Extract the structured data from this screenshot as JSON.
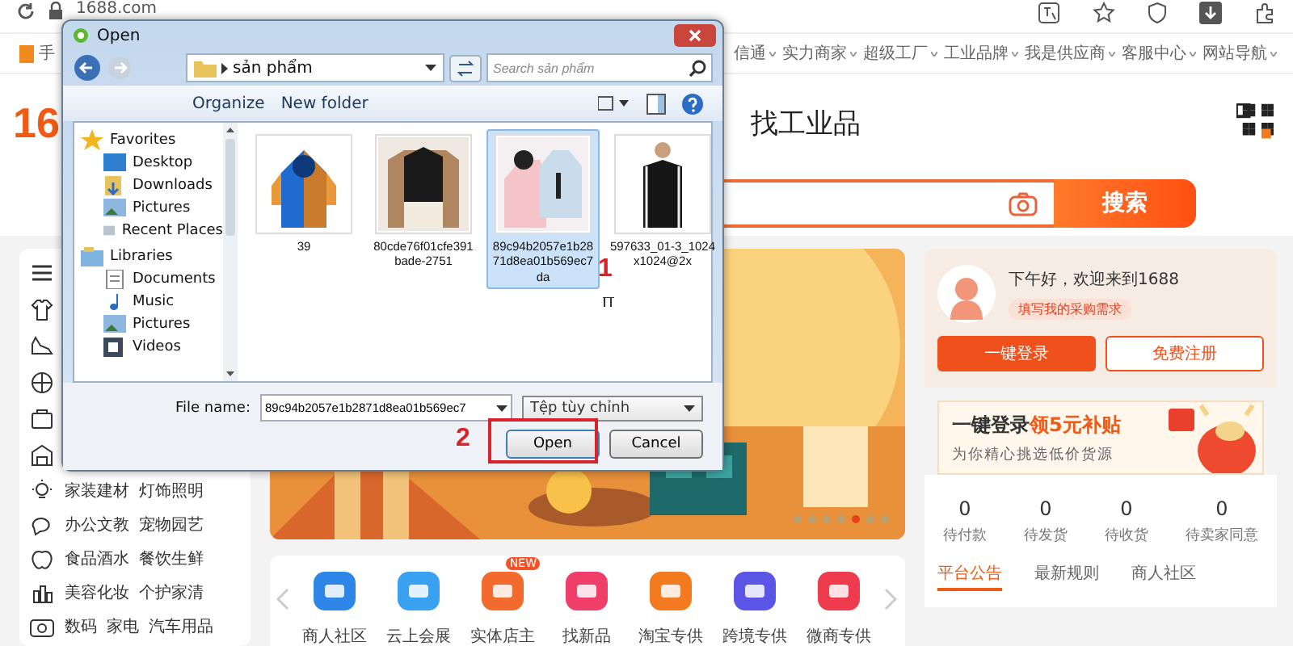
{
  "browser": {
    "url": "1688.com"
  },
  "top_nav": [
    {
      "label": "手"
    },
    {
      "label": "信通"
    },
    {
      "label": "实力商家"
    },
    {
      "label": "超级工厂"
    },
    {
      "label": "工业品牌"
    },
    {
      "label": "我是供应商"
    },
    {
      "label": "客服中心"
    },
    {
      "label": "网站导航"
    }
  ],
  "header": {
    "logo": "16",
    "title": "找工业品"
  },
  "search": {
    "button": "搜索"
  },
  "categories": [
    {
      "labels": [
        "家装建材",
        "灯饰照明"
      ]
    },
    {
      "labels": [
        "办公文教",
        "宠物园艺"
      ]
    },
    {
      "labels": [
        "食品酒水",
        "餐饮生鲜"
      ]
    },
    {
      "labels": [
        "美容化妆",
        "个护家清"
      ]
    },
    {
      "labels": [
        "数码",
        "家电",
        "汽车用品"
      ]
    }
  ],
  "banner": {
    "kind": "picture",
    "dots": [
      {
        "selected": false
      },
      {
        "selected": false
      },
      {
        "selected": false
      },
      {
        "selected": false
      },
      {
        "selected": true
      },
      {
        "selected": false
      },
      {
        "selected": false
      }
    ]
  },
  "services": [
    {
      "label": "商人社区",
      "color": "#2e86e8"
    },
    {
      "label": "云上会展",
      "color": "#3aa0f0"
    },
    {
      "label": "实体店主",
      "color": "#f26a2e",
      "badge": "NEW"
    },
    {
      "label": "找新品",
      "color": "#ef3e6a"
    },
    {
      "label": "淘宝专供",
      "color": "#f47a1f"
    },
    {
      "label": "跨境专供",
      "color": "#5b55e6"
    },
    {
      "label": "微商专供",
      "color": "#ef3b4e"
    }
  ],
  "user_panel": {
    "greeting": "下午好，欢迎来到1688",
    "demand": "填写我的采购需求",
    "login": "一键登录",
    "register": "免费注册",
    "promo_title": "一键登录",
    "promo_highlight": "领5元补贴",
    "promo_sub": "为你精心挑选低价货源",
    "orders": [
      {
        "count": "0",
        "label": "待付款"
      },
      {
        "count": "0",
        "label": "待发货"
      },
      {
        "count": "0",
        "label": "待收货"
      },
      {
        "count": "0",
        "label": "待卖家同意"
      }
    ],
    "tabs": [
      {
        "label": "平台公告",
        "selected": true
      },
      {
        "label": "最新规则",
        "selected": false
      },
      {
        "label": "商人社区",
        "selected": false
      }
    ]
  },
  "dialog": {
    "title": "Open",
    "path": "sản phẩm",
    "search_placeholder": "Search sản phẩm",
    "toolbar": [
      "Organize",
      "New folder"
    ],
    "nav": [
      {
        "label": "Favorites",
        "children": [
          {
            "label": "Desktop"
          },
          {
            "label": "Downloads"
          },
          {
            "label": "Pictures"
          },
          {
            "label": "Recent Places"
          }
        ]
      },
      {
        "label": "Libraries",
        "children": [
          {
            "label": "Documents"
          },
          {
            "label": "Music"
          },
          {
            "label": "Pictures"
          },
          {
            "label": "Videos"
          }
        ]
      }
    ],
    "files": [
      {
        "name": "39",
        "selected": false,
        "kind": "picture"
      },
      {
        "name": "80cde76f01cfe391 bade-2751",
        "selected": false,
        "kind": "picture"
      },
      {
        "name": "89c94b2057e1b28 71d8ea01b569ec7 da",
        "selected": true,
        "kind": "picture"
      },
      {
        "name": "597633_01-3_1024 x1024@2x",
        "selected": false,
        "kind": "picture"
      }
    ],
    "file_name_label": "File name:",
    "file_name": "89c94b2057e1b2871d8ea01b569ec7",
    "file_type": "Tệp tùy chỉnh",
    "buttons": [
      "Open",
      "Cancel"
    ]
  },
  "annotations": [
    {
      "label": "1"
    },
    {
      "label": "2"
    }
  ]
}
